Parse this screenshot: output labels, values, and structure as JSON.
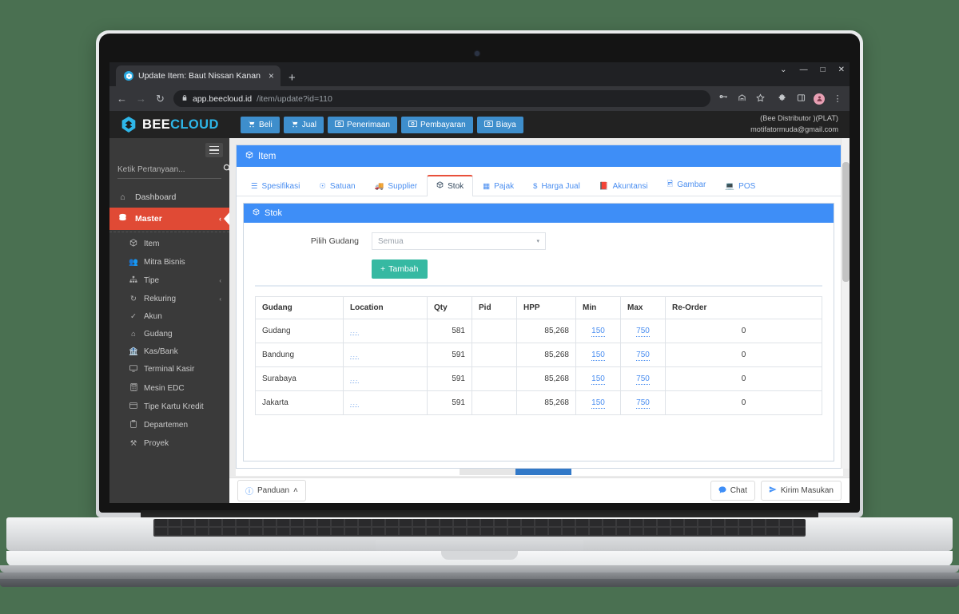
{
  "browser": {
    "tab": {
      "title": "Update Item: Baut Nissan Kanan",
      "favicon": "bee-favicon",
      "close": "×"
    },
    "new_tab": "+",
    "window_controls": {
      "minimize_group": "⌄",
      "minimize": "—",
      "maximize": "□",
      "close": "✕"
    },
    "nav": {
      "back": "←",
      "forward": "→",
      "reload": "↻"
    },
    "omnibox": {
      "lock": "🔒",
      "host": "app.beecloud.id",
      "path": "/item/update?id=110"
    },
    "toolbar_icons": [
      "key-icon",
      "share-icon",
      "bookmark-star-icon",
      "extensions-puzzle-icon",
      "side-panel-icon",
      "profile-avatar",
      "browser-menu-icon"
    ]
  },
  "app": {
    "brand": {
      "bee": "BEE",
      "cloud": "CLOUD"
    },
    "topnav": [
      {
        "label": "Beli",
        "icon": "cart-icon"
      },
      {
        "label": "Jual",
        "icon": "cart-icon"
      },
      {
        "label": "Penerimaan",
        "icon": "money-icon"
      },
      {
        "label": "Pembayaran",
        "icon": "money-icon"
      },
      {
        "label": "Biaya",
        "icon": "money-icon"
      }
    ],
    "user": {
      "company": "(Bee Distributor )(PLAT)",
      "email": "motifatormuda@gmail.com"
    }
  },
  "sidebar": {
    "search_placeholder": "Ketik Pertanyaan...",
    "items": [
      {
        "label": "Dashboard",
        "icon": "home-icon",
        "active": false
      },
      {
        "label": "Master",
        "icon": "database-icon",
        "active": true,
        "caret": "‹"
      }
    ],
    "subitems": [
      {
        "label": "Item",
        "icon": "box-icon"
      },
      {
        "label": "Mitra Bisnis",
        "icon": "users-icon"
      },
      {
        "label": "Tipe",
        "icon": "sitemap-icon",
        "caret": "‹"
      },
      {
        "label": "Rekuring",
        "icon": "refresh-icon",
        "caret": "‹"
      },
      {
        "label": "Akun",
        "icon": "check-icon"
      },
      {
        "label": "Gudang",
        "icon": "warehouse-icon"
      },
      {
        "label": "Kas/Bank",
        "icon": "bank-icon"
      },
      {
        "label": "Terminal Kasir",
        "icon": "monitor-icon"
      },
      {
        "label": "Mesin EDC",
        "icon": "calculator-icon"
      },
      {
        "label": "Tipe Kartu Kredit",
        "icon": "credit-card-icon"
      },
      {
        "label": "Departemen",
        "icon": "clipboard-icon"
      },
      {
        "label": "Proyek",
        "icon": "tools-icon"
      }
    ]
  },
  "page": {
    "card_title": "Item",
    "card_title_icon": "box-icon",
    "tabs": [
      {
        "label": "Spesifikasi",
        "icon": "list-icon",
        "active": false
      },
      {
        "label": "Satuan",
        "icon": "check-circle-icon",
        "active": false
      },
      {
        "label": "Supplier",
        "icon": "truck-icon",
        "active": false
      },
      {
        "label": "Stok",
        "icon": "box-icon",
        "active": true
      },
      {
        "label": "Pajak",
        "icon": "calculator-icon",
        "active": false
      },
      {
        "label": "Harga Jual",
        "icon": "dollar-icon",
        "active": false
      },
      {
        "label": "Akuntansi",
        "icon": "book-icon",
        "active": false
      },
      {
        "label": "Gambar",
        "icon": "image-icon",
        "active": false
      },
      {
        "label": "POS",
        "icon": "monitor-icon",
        "active": false
      }
    ],
    "stok": {
      "panel_title": "Stok",
      "panel_icon": "box-icon",
      "filter_label": "Pilih Gudang",
      "filter_value": "Semua",
      "filter_caret": "▾",
      "add_button": "Tambah",
      "add_button_icon": "plus-icon",
      "columns": [
        "Gudang",
        "Location",
        "Qty",
        "Pid",
        "HPP",
        "Min",
        "Max",
        "Re-Order"
      ],
      "rows": [
        {
          "gudang": "Gudang",
          "location": "...",
          "qty": "581",
          "pid": "",
          "hpp": "85,268",
          "min": "150",
          "max": "750",
          "reorder": "0"
        },
        {
          "gudang": "Bandung",
          "location": "...",
          "qty": "591",
          "pid": "",
          "hpp": "85,268",
          "min": "150",
          "max": "750",
          "reorder": "0"
        },
        {
          "gudang": "Surabaya",
          "location": "...",
          "qty": "591",
          "pid": "",
          "hpp": "85,268",
          "min": "150",
          "max": "750",
          "reorder": "0"
        },
        {
          "gudang": "Jakarta",
          "location": "...",
          "qty": "591",
          "pid": "",
          "hpp": "85,268",
          "min": "150",
          "max": "750",
          "reorder": "0"
        }
      ]
    }
  },
  "footer": {
    "panduan": "Panduan",
    "panduan_caret": "˄",
    "panduan_icon": "question-circle-icon",
    "chat": "Chat",
    "chat_icon": "chat-bubble-icon",
    "feedback": "Kirim Masukan",
    "feedback_icon": "send-icon"
  },
  "colors": {
    "background": "#4a7051",
    "accent_blue": "#3e8ef7",
    "active_red": "#e04a35",
    "teal_button": "#36b9a2",
    "brand_cyan": "#2eb6e8"
  }
}
